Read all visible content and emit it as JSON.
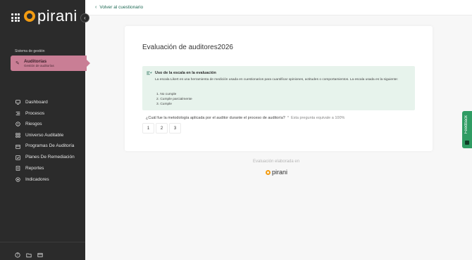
{
  "brand": {
    "name": "pirani",
    "accent": "#f39c12"
  },
  "sidebar": {
    "section_label": "Sistema de gestión",
    "active_module": {
      "title": "Auditorías",
      "subtitle": "Gestión de auditorías",
      "color": "#c97e95"
    },
    "items": [
      {
        "label": "Dashboard",
        "icon": "monitor-icon"
      },
      {
        "label": "Procesos",
        "icon": "list-icon"
      },
      {
        "label": "Riesgos",
        "icon": "alert-circle-icon"
      },
      {
        "label": "Universo Auditable",
        "icon": "grid-icon"
      },
      {
        "label": "Programas De Auditoría",
        "icon": "calendar-icon"
      },
      {
        "label": "Planes De Remediación",
        "icon": "checkbox-icon"
      },
      {
        "label": "Reportes",
        "icon": "report-icon"
      },
      {
        "label": "Indicadores",
        "icon": "target-icon"
      }
    ],
    "footer_icons": [
      "help-icon",
      "folder-icon",
      "card-icon"
    ]
  },
  "topbar": {
    "back_label": "Volver al cuestionario"
  },
  "card": {
    "title": "Evaluación de auditores2026",
    "info": {
      "title": "Uso de la escala en la evaluación",
      "description": "La escala Likert es una herramienta de medición usada en cuestionarios para cuantificar opiniones, actitudes o comportamientos. La escala usada es la siguiente:",
      "list": [
        "1. No cumple",
        "2. Cumple parcialmente",
        "3. Cumple"
      ]
    },
    "question": {
      "text": "¿Cuál fue la metodología aplicada por el auditor durante el proceso de auditoría?",
      "asterisk": "*",
      "weight": "Esta pregunta equivale a 100%"
    },
    "options": [
      "1",
      "2",
      "3"
    ]
  },
  "footer": {
    "made_with": "Evaluación elaborada en",
    "logo": "pirani"
  },
  "feedback": {
    "label": "Feedback",
    "color": "#2f9c63"
  }
}
